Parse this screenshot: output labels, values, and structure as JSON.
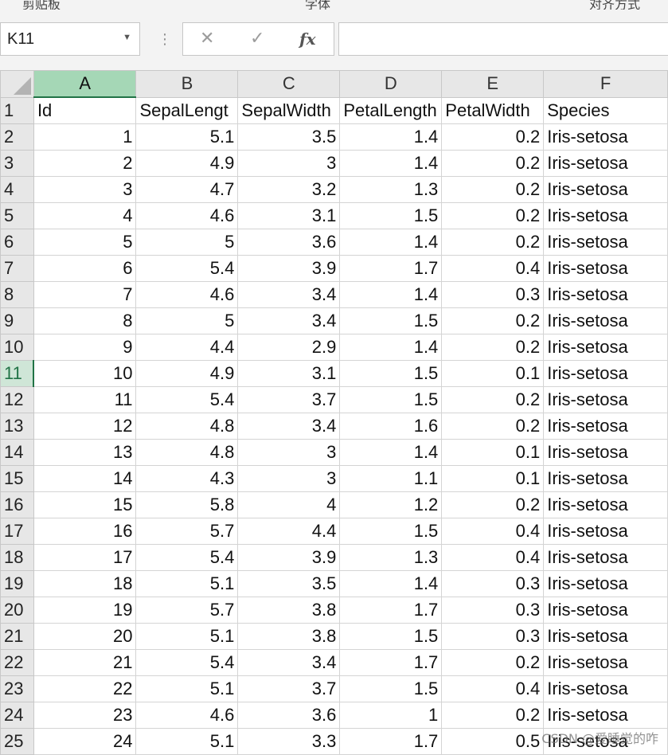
{
  "ribbon_fragments": [
    "剪贴板",
    "字体",
    "对齐方式"
  ],
  "formula_bar": {
    "name_box": "K11",
    "cancel_glyph": "✕",
    "enter_glyph": "✓",
    "fx_label": "fx",
    "formula_value": ""
  },
  "columns": [
    "A",
    "B",
    "C",
    "D",
    "E",
    "F"
  ],
  "selected_column": "A",
  "selected_row": 11,
  "header_row": [
    "Id",
    "SepalLengt",
    "SepalWidth",
    "PetalLength",
    "PetalWidth",
    "Species"
  ],
  "rows": [
    [
      "1",
      "5.1",
      "3.5",
      "1.4",
      "0.2",
      "Iris-setosa"
    ],
    [
      "2",
      "4.9",
      "3",
      "1.4",
      "0.2",
      "Iris-setosa"
    ],
    [
      "3",
      "4.7",
      "3.2",
      "1.3",
      "0.2",
      "Iris-setosa"
    ],
    [
      "4",
      "4.6",
      "3.1",
      "1.5",
      "0.2",
      "Iris-setosa"
    ],
    [
      "5",
      "5",
      "3.6",
      "1.4",
      "0.2",
      "Iris-setosa"
    ],
    [
      "6",
      "5.4",
      "3.9",
      "1.7",
      "0.4",
      "Iris-setosa"
    ],
    [
      "7",
      "4.6",
      "3.4",
      "1.4",
      "0.3",
      "Iris-setosa"
    ],
    [
      "8",
      "5",
      "3.4",
      "1.5",
      "0.2",
      "Iris-setosa"
    ],
    [
      "9",
      "4.4",
      "2.9",
      "1.4",
      "0.2",
      "Iris-setosa"
    ],
    [
      "10",
      "4.9",
      "3.1",
      "1.5",
      "0.1",
      "Iris-setosa"
    ],
    [
      "11",
      "5.4",
      "3.7",
      "1.5",
      "0.2",
      "Iris-setosa"
    ],
    [
      "12",
      "4.8",
      "3.4",
      "1.6",
      "0.2",
      "Iris-setosa"
    ],
    [
      "13",
      "4.8",
      "3",
      "1.4",
      "0.1",
      "Iris-setosa"
    ],
    [
      "14",
      "4.3",
      "3",
      "1.1",
      "0.1",
      "Iris-setosa"
    ],
    [
      "15",
      "5.8",
      "4",
      "1.2",
      "0.2",
      "Iris-setosa"
    ],
    [
      "16",
      "5.7",
      "4.4",
      "1.5",
      "0.4",
      "Iris-setosa"
    ],
    [
      "17",
      "5.4",
      "3.9",
      "1.3",
      "0.4",
      "Iris-setosa"
    ],
    [
      "18",
      "5.1",
      "3.5",
      "1.4",
      "0.3",
      "Iris-setosa"
    ],
    [
      "19",
      "5.7",
      "3.8",
      "1.7",
      "0.3",
      "Iris-setosa"
    ],
    [
      "20",
      "5.1",
      "3.8",
      "1.5",
      "0.3",
      "Iris-setosa"
    ],
    [
      "21",
      "5.4",
      "3.4",
      "1.7",
      "0.2",
      "Iris-setosa"
    ],
    [
      "22",
      "5.1",
      "3.7",
      "1.5",
      "0.4",
      "Iris-setosa"
    ],
    [
      "23",
      "4.6",
      "3.6",
      "1",
      "0.2",
      "Iris-setosa"
    ],
    [
      "24",
      "5.1",
      "3.3",
      "1.7",
      "0.5",
      "Iris-setosa"
    ]
  ],
  "watermark": "CSDN @爱睡觉的咋",
  "colors": {
    "selection_green": "#217346",
    "header_fill": "#e7e7e7",
    "selected_header_fill": "#a5d7b6"
  }
}
